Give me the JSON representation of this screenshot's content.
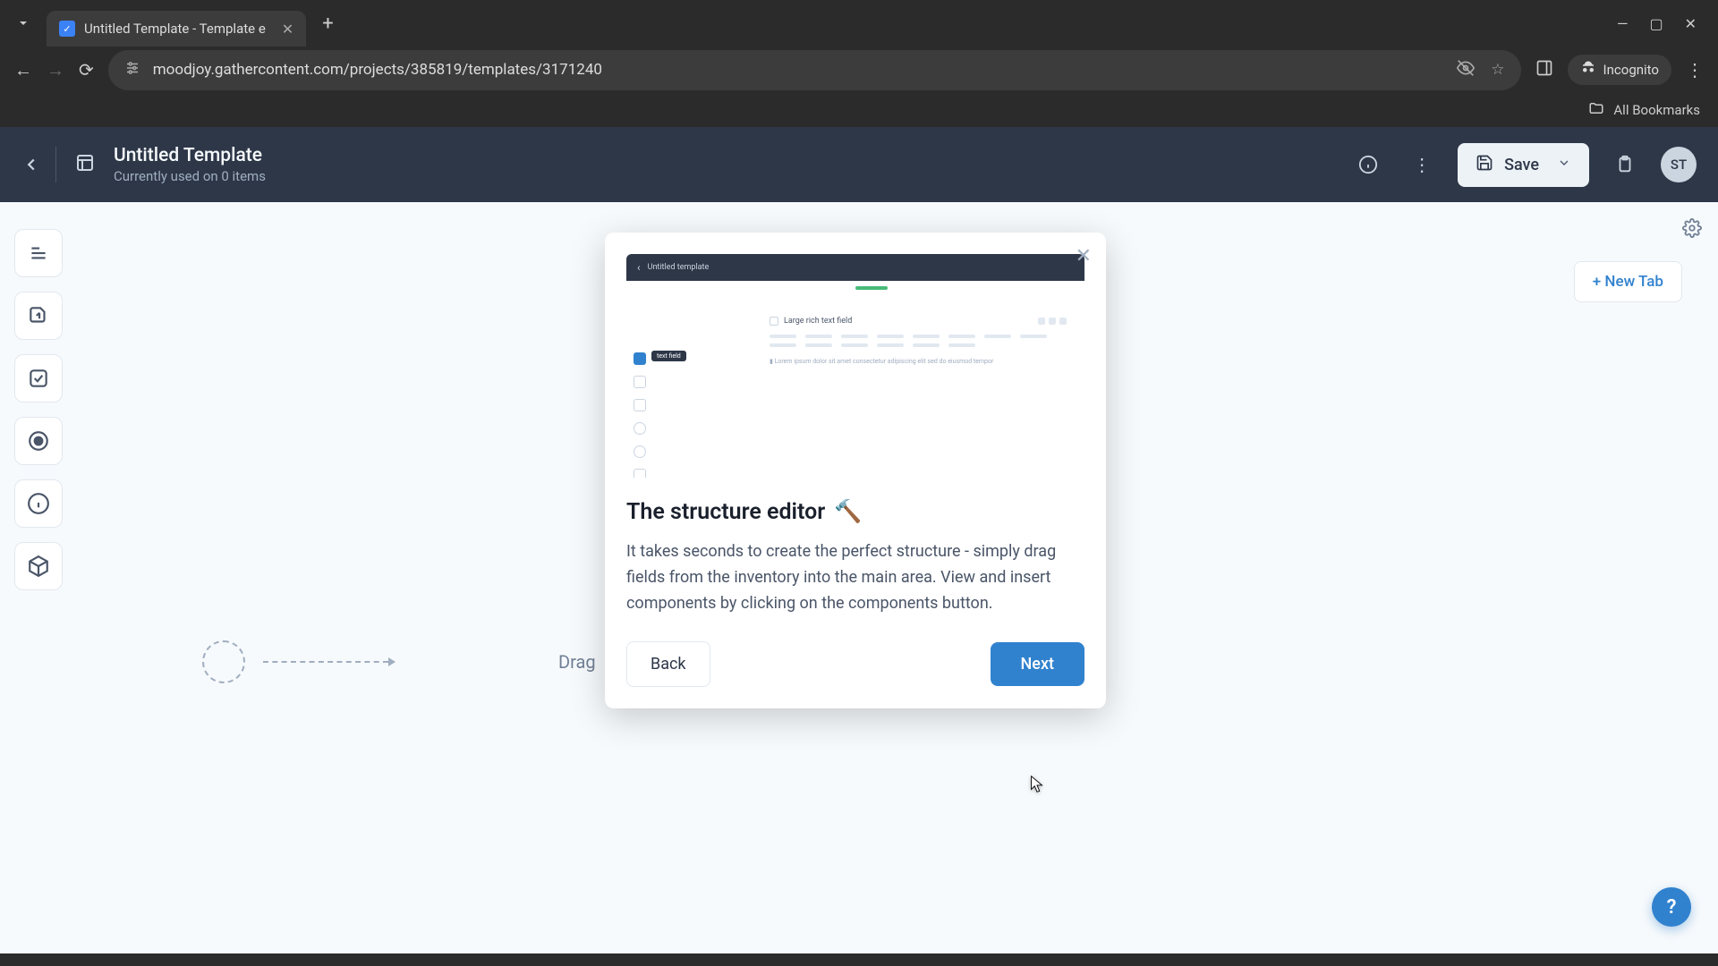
{
  "browser": {
    "tab_title": "Untitled Template - Template e",
    "url": "moodjoy.gathercontent.com/projects/385819/templates/3171240",
    "incognito_label": "Incognito",
    "bookmarks_label": "All Bookmarks"
  },
  "header": {
    "title": "Untitled Template",
    "subtitle": "Currently used on 0 items",
    "save_label": "Save",
    "avatar_initials": "ST"
  },
  "canvas": {
    "new_tab_label": "+ New Tab",
    "drag_hint": "Drag"
  },
  "modal": {
    "title": "The structure editor",
    "emoji": "🔨",
    "body": "It takes seconds to create the perfect structure - simply drag fields from the inventory into the main area. View and insert components by clicking on the components button.",
    "back_label": "Back",
    "next_label": "Next",
    "preview_header": "Untitled template",
    "preview_tool_label": "text field",
    "preview_field_label": "Large rich text field"
  },
  "help": {
    "label": "?"
  }
}
